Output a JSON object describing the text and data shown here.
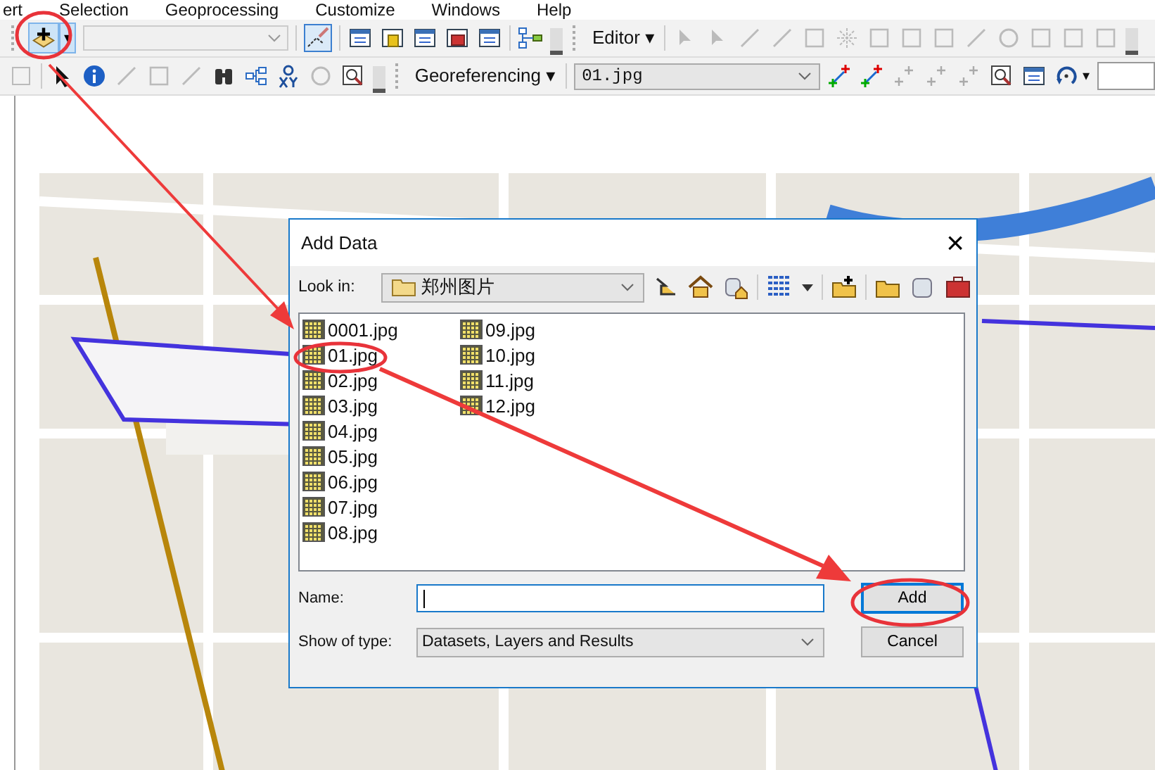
{
  "menu_bar": {
    "items": [
      "ert",
      "Selection",
      "Geoprocessing",
      "Customize",
      "Windows",
      "Help"
    ]
  },
  "toolbar": {
    "editor_menu": "Editor",
    "caret": "▾",
    "georeferencing_menu": "Georeferencing",
    "layer_dropdown": "01.jpg"
  },
  "dialog": {
    "title": "Add Data",
    "close": "×",
    "look_in_label": "Look in:",
    "look_in_value": "郑州图片",
    "files": [
      "0001.jpg",
      "01.jpg",
      "02.jpg",
      "03.jpg",
      "04.jpg",
      "05.jpg",
      "06.jpg",
      "07.jpg",
      "08.jpg",
      "09.jpg",
      "10.jpg",
      "11.jpg",
      "12.jpg"
    ],
    "name_label": "Name:",
    "type_label": "Show of type:",
    "type_value": "Datasets, Layers and Results",
    "buttons": [
      {
        "label": "Add",
        "kind": "default"
      },
      {
        "label": "Cancel",
        "kind": "normal"
      }
    ]
  }
}
